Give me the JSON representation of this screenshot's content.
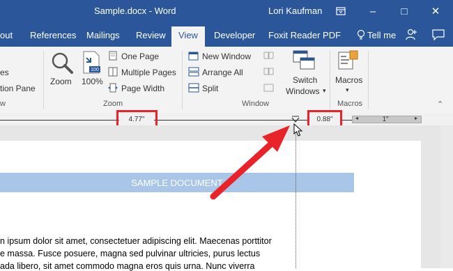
{
  "titlebar": {
    "doc_title": "Sample.docx  -  Word",
    "user_name": "Lori Kaufman",
    "restore_icon": "ribbon-display-icon",
    "minimize": "–",
    "maximize": "□",
    "close": "✕"
  },
  "tabs": [
    {
      "label": "out"
    },
    {
      "label": "References"
    },
    {
      "label": "Mailings"
    },
    {
      "label": "Review"
    },
    {
      "label": "View"
    },
    {
      "label": "Developer"
    },
    {
      "label": "Foxit Reader PDF"
    },
    {
      "label": "Tell me"
    }
  ],
  "ribbon": {
    "left_partial": [
      "es",
      "tion Pane"
    ],
    "zoom_group": {
      "zoom": "Zoom",
      "hundred": "100%",
      "one_page": "One Page",
      "multiple_pages": "Multiple Pages",
      "page_width": "Page Width",
      "label": "Zoom"
    },
    "window_group": {
      "new_window": "New Window",
      "arrange_all": "Arrange All",
      "split": "Split",
      "switch_line1": "Switch",
      "switch_line2": "Windows",
      "label": "Window"
    },
    "macros_group": {
      "macros": "Macros",
      "label": "Macros"
    },
    "left_group_label_partial": "w",
    "colors": {
      "accent": "#2b579a",
      "ribbon_bg": "#f3f3f3"
    }
  },
  "ruler": {
    "left_measure": "4.77\"",
    "right_measure": "0.88\"",
    "ruler_mark": "1\""
  },
  "document": {
    "heading": "SAMPLE DOCUMENT",
    "lines": [
      "n ipsum dolor sit amet, consectetuer adipiscing elit. Maecenas porttitor",
      "e massa. Fusce posuere, magna sed pulvinar ultricies, purus lectus",
      "ada libero, sit amet commodo magna eros quis urna. Nunc viverra"
    ]
  },
  "annotation": {
    "color": "#e8242a"
  }
}
